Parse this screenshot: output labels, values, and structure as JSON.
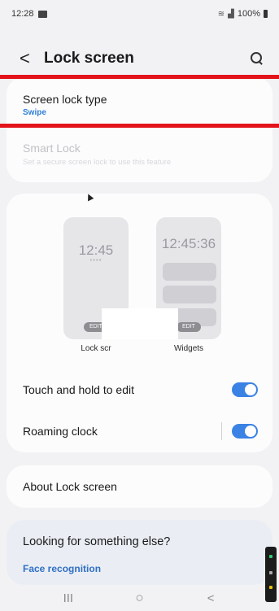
{
  "status_bar": {
    "time": "12:28",
    "battery": "100%",
    "icons": [
      "notification-icon",
      "wifi-icon",
      "signal-icon",
      "battery-icon"
    ]
  },
  "header": {
    "back_glyph": "<",
    "title": "Lock screen"
  },
  "settings": {
    "screen_lock_type": {
      "label": "Screen lock type",
      "value": "Swipe"
    },
    "smart_lock": {
      "label": "Smart Lock",
      "description": "Set a secure screen lock to use this feature"
    }
  },
  "previews": [
    {
      "clock": "12:45",
      "pin_dots": "****",
      "edit": "EDIT",
      "label": "Lock scr"
    },
    {
      "clock": "12:45:36",
      "edit": "EDIT",
      "label": "Widgets"
    }
  ],
  "toggles": [
    {
      "label": "Touch and hold to edit",
      "enabled": true
    },
    {
      "label": "Roaming clock",
      "enabled": true
    }
  ],
  "about": {
    "label": "About Lock screen"
  },
  "suggestions": {
    "title": "Looking for something else?",
    "link": "Face recognition"
  },
  "nav_bar": {
    "recents_glyph": "III",
    "home_glyph": "○",
    "back_glyph": "<"
  },
  "colors": {
    "accent_blue": "#2f7fd6",
    "toggle_on": "#3a82e4",
    "highlight_red": "#e3131b",
    "background": "#f2f2f4"
  }
}
